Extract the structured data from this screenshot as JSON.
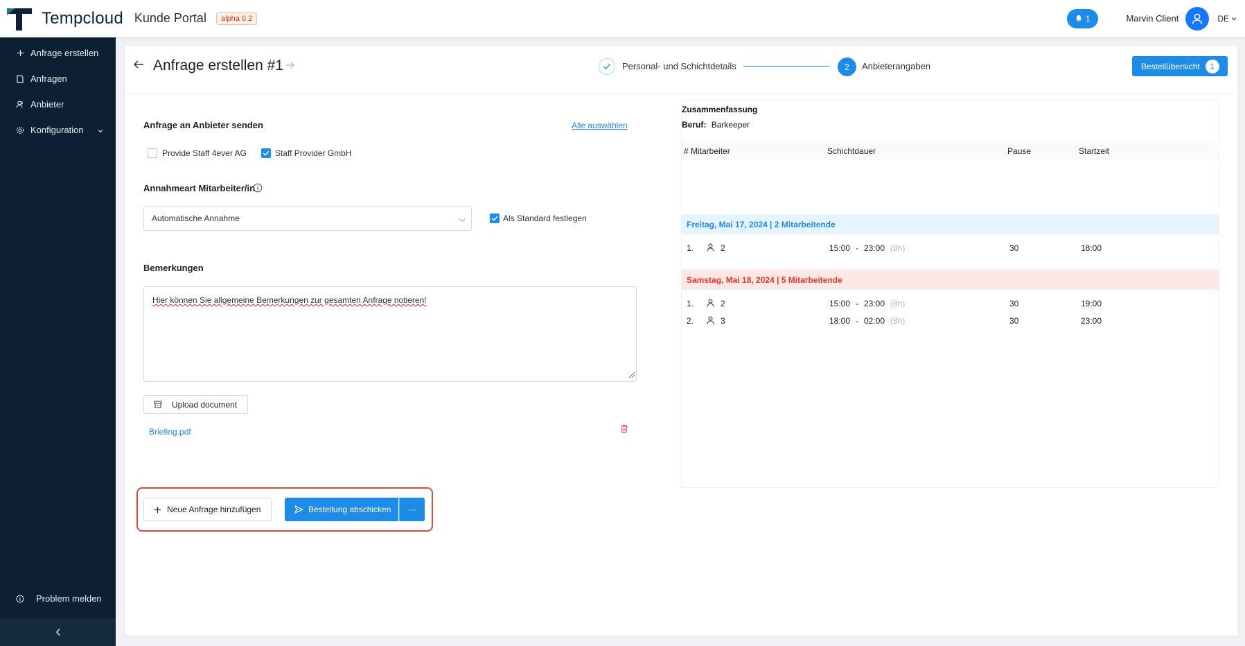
{
  "brand": {
    "name": "Tempcloud",
    "portal": "Kunde Portal",
    "badge": "alpha 0.2"
  },
  "topbar": {
    "notification_count": "1",
    "user_name": "Marvin Client",
    "language": "DE"
  },
  "sidebar": {
    "items": [
      {
        "label": "Anfrage erstellen",
        "icon": "plus-icon"
      },
      {
        "label": "Anfragen",
        "icon": "document-icon"
      },
      {
        "label": "Anbieter",
        "icon": "users-icon"
      },
      {
        "label": "Konfiguration",
        "icon": "gear-icon"
      }
    ],
    "report_problem": "Problem melden"
  },
  "header": {
    "title": "Anfrage erstellen #1",
    "steps": [
      {
        "number": "1",
        "label": "Personal- und Schichtdetails",
        "status": "done"
      },
      {
        "number": "2",
        "label": "Anbieterangaben",
        "status": "active"
      }
    ],
    "order_overview_label": "Bestellübersicht",
    "order_overview_count": "1"
  },
  "form": {
    "send_to_label": "Anfrage an Anbieter senden",
    "select_all_link": "Alle auswählen",
    "providers": [
      {
        "name": "Provide Staff 4ever AG",
        "checked": false
      },
      {
        "name": "Staff Provider GmbH",
        "checked": true
      }
    ],
    "acceptance_label": "Annahmeart Mitarbeiter/in",
    "acceptance_value": "Automatische Annahme",
    "set_default_label": "Als Standard festlegen",
    "set_default_checked": true,
    "remarks_label": "Bemerkungen",
    "remarks_text": "Hier können Sie allgemeine Bemerkungen zur gesamten Anfrage notieren!",
    "upload_label": "Upload document",
    "file_name": "Briefing.pdf",
    "new_request_label": "Neue Anfrage hinzufügen",
    "submit_label": "Bestellung abschicken",
    "more_label": "···"
  },
  "summary": {
    "title": "Zusammenfassung",
    "beruf_label": "Beruf:",
    "beruf_value": "Barkeeper",
    "columns": [
      "# Mitarbeiter",
      "Schichtdauer",
      "Pause",
      "Startzeit"
    ],
    "days": [
      {
        "label": "Freitag, Mai 17, 2024 | 2 Mitarbeitende",
        "color": "#1d8ce8",
        "background": "#e6f4ff",
        "rows": [
          {
            "num": "1.",
            "staff": "2",
            "from": "15:00",
            "sep": "-",
            "to": "23:00",
            "duration": "(8h)",
            "pause": "30",
            "start": "18:00"
          }
        ]
      },
      {
        "label": "Samstag, Mai 18, 2024 | 5 Mitarbeitende",
        "color": "#e0352b",
        "background": "#fde8e6",
        "rows": [
          {
            "num": "1.",
            "staff": "2",
            "from": "15:00",
            "sep": "-",
            "to": "23:00",
            "duration": "(8h)",
            "pause": "30",
            "start": "19:00"
          },
          {
            "num": "2.",
            "staff": "3",
            "from": "18:00",
            "sep": "-",
            "to": "02:00",
            "duration": "(8h)",
            "pause": "30",
            "start": "23:00"
          }
        ]
      }
    ]
  }
}
